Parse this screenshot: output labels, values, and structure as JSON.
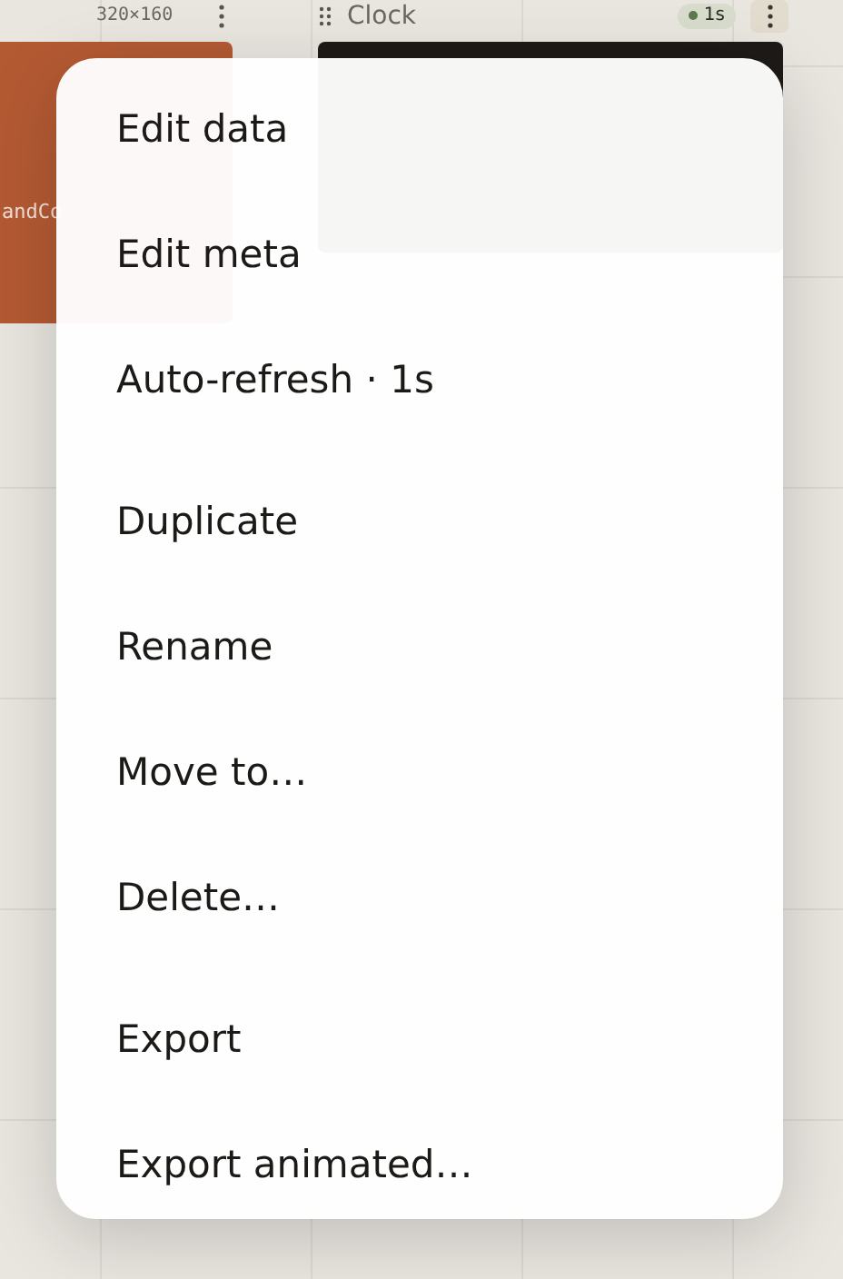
{
  "cards": [
    {
      "kind": "code",
      "size_label": "320×160",
      "snippet": "andCo"
    },
    {
      "kind": "clock",
      "title": "Clock",
      "badge": "1s"
    }
  ],
  "menu": {
    "groups": [
      [
        {
          "label": "Edit data"
        },
        {
          "label": "Edit meta"
        },
        {
          "label": "Auto-refresh · 1s"
        }
      ],
      [
        {
          "label": "Duplicate"
        },
        {
          "label": "Rename"
        },
        {
          "label": "Move to…"
        },
        {
          "label": "Delete…"
        }
      ],
      [
        {
          "label": "Export"
        },
        {
          "label": "Export animated…"
        }
      ]
    ]
  }
}
